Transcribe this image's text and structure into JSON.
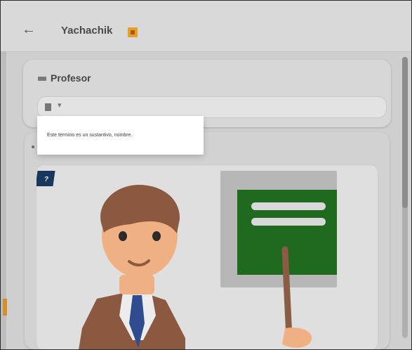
{
  "appbar": {
    "title": "Yachachik"
  },
  "word_card": {
    "label": "Profesor"
  },
  "tooltip": {
    "text": "Este termino es un sustantivo, nombre."
  },
  "icons": [
    "back-arrow-icon",
    "flag-icon",
    "book-icon",
    "chevron-down-icon",
    "picture-thumbnail-icon"
  ],
  "colors": {
    "accent": "#e89e28",
    "board": "#1f6a1f",
    "tie": "#2f4c8f"
  }
}
